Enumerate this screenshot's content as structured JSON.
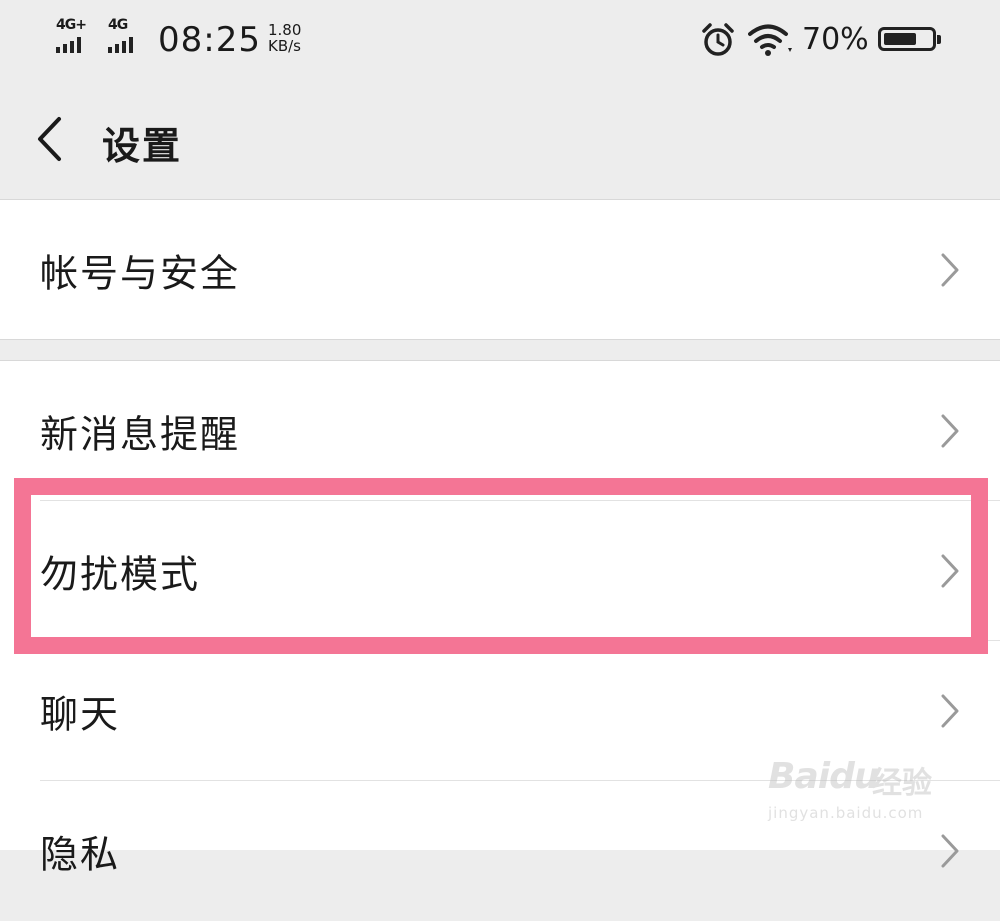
{
  "status_bar": {
    "signal1_label": "4G+",
    "signal2_label": "4G",
    "time": "08:25",
    "speed_value": "1.80",
    "speed_unit": "KB/s",
    "battery_percent": "70%",
    "battery_level": 0.7
  },
  "header": {
    "back_icon": "chevron-left-icon",
    "title": "设置"
  },
  "settings": {
    "groups": [
      {
        "items": [
          {
            "label": "帐号与安全"
          }
        ]
      },
      {
        "items": [
          {
            "label": "新消息提醒"
          },
          {
            "label": "勿扰模式",
            "highlighted": true
          },
          {
            "label": "聊天"
          },
          {
            "label": "隐私"
          }
        ]
      }
    ]
  },
  "highlight_color": "#f47595",
  "watermark": {
    "logo": "Baidu",
    "cn": "经验",
    "url": "jingyan.baidu.com"
  }
}
